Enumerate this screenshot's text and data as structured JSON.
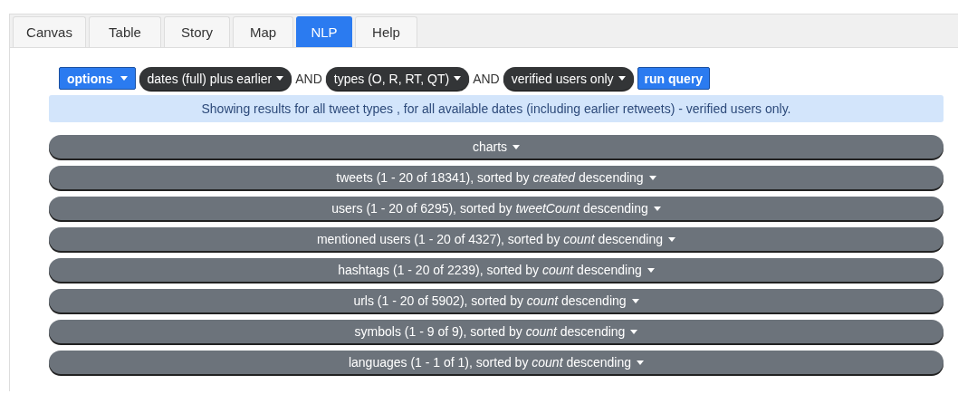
{
  "tabs": [
    {
      "label": "Canvas",
      "selected": false
    },
    {
      "label": "Table",
      "selected": false
    },
    {
      "label": "Story",
      "selected": false
    },
    {
      "label": "Map",
      "selected": false
    },
    {
      "label": "NLP",
      "selected": true
    },
    {
      "label": "Help",
      "selected": false
    }
  ],
  "query_bar": [
    {
      "kind": "menu",
      "label": "options"
    },
    {
      "kind": "pill",
      "label": "dates (full) plus earlier"
    },
    {
      "kind": "and",
      "label": "AND"
    },
    {
      "kind": "pill",
      "label": "types (O, R, RT, QT)"
    },
    {
      "kind": "and",
      "label": "AND"
    },
    {
      "kind": "pill",
      "label": "verified users only"
    },
    {
      "kind": "run",
      "label": "run query"
    }
  ],
  "info": "Showing results for all tweet types , for all available dates (including earlier retweets) - verified users only.",
  "sections": [
    {
      "label": "charts"
    },
    {
      "label": "tweets (1 - 20 of 18341), sorted by *created* descending"
    },
    {
      "label": "users (1 - 20 of 6295), sorted by *tweetCount* descending"
    },
    {
      "label": "mentioned users (1 - 20 of 4327), sorted by *count* descending"
    },
    {
      "label": "hashtags (1 - 20 of 2239), sorted by *count* descending"
    },
    {
      "label": "urls (1 - 20 of 5902), sorted by *count* descending"
    },
    {
      "label": "symbols (1 - 9 of 9), sorted by *count* descending"
    },
    {
      "label": "languages (1 - 1 of 1), sorted by *count* descending"
    }
  ]
}
